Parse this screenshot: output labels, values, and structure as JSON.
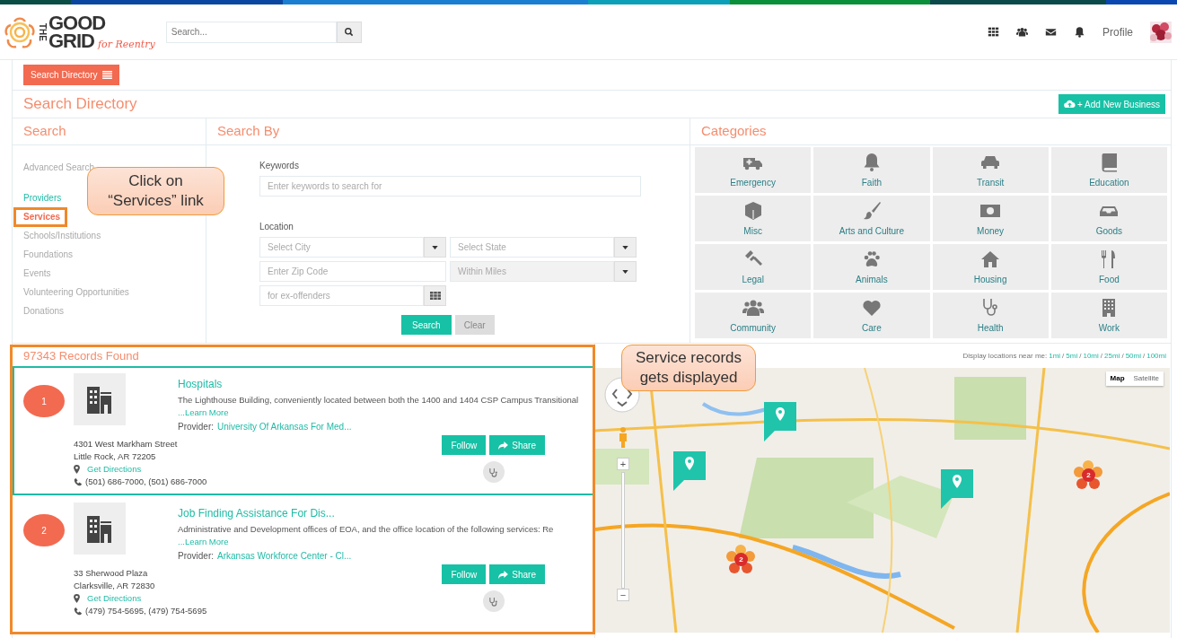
{
  "logo": {
    "the": "THE",
    "good": "GOOD",
    "grid": "GRID",
    "tagline": "for Reentry"
  },
  "header": {
    "search": {
      "placeholder": "Search..."
    },
    "profile": "Profile"
  },
  "toolbar": {
    "directory_button": "Search Directory"
  },
  "page": {
    "title": "Search Directory",
    "add_button": "+ Add New Business"
  },
  "search_panel": {
    "title": "Search",
    "advanced": "Advanced Search",
    "items": [
      {
        "label": "Providers",
        "color": "#1fbba6",
        "selected": false
      },
      {
        "label": "Services",
        "color": "#f26a50",
        "selected": true
      },
      {
        "label": "Schools/Institutions",
        "color": "#aaaaaa",
        "selected": false
      },
      {
        "label": "Foundations",
        "color": "#aaaaaa",
        "selected": false
      },
      {
        "label": "Events",
        "color": "#aaaaaa",
        "selected": false
      },
      {
        "label": "Volunteering Opportunities",
        "color": "#aaaaaa",
        "selected": false
      },
      {
        "label": "Donations",
        "color": "#aaaaaa",
        "selected": false
      }
    ]
  },
  "search_by": {
    "title": "Search By",
    "keywords_label": "Keywords",
    "keywords": {
      "placeholder": "Enter keywords to search for"
    },
    "location_label": "Location",
    "city": {
      "placeholder": "Select City",
      "disabled": false
    },
    "state": {
      "placeholder": "Select State",
      "disabled": false
    },
    "zip": {
      "placeholder": "Enter Zip Code"
    },
    "miles": {
      "placeholder": "Within Miles",
      "disabled": true
    },
    "tag": {
      "placeholder": "for ex-offenders"
    },
    "search_button": "Search",
    "clear_button": "Clear"
  },
  "categories": {
    "title": "Categories",
    "items": [
      {
        "label": "Emergency"
      },
      {
        "label": "Faith"
      },
      {
        "label": "Transit"
      },
      {
        "label": "Education"
      },
      {
        "label": "Misc"
      },
      {
        "label": "Arts and Culture"
      },
      {
        "label": "Money"
      },
      {
        "label": "Goods"
      },
      {
        "label": "Legal"
      },
      {
        "label": "Animals"
      },
      {
        "label": "Housing"
      },
      {
        "label": "Food"
      },
      {
        "label": "Community"
      },
      {
        "label": "Care"
      },
      {
        "label": "Health"
      },
      {
        "label": "Work"
      }
    ]
  },
  "results": {
    "count": "97343 Records Found",
    "records": [
      {
        "number": "1",
        "title": "Hospitals",
        "description": "The Lighthouse Building, conveniently located between both the 1400 and 1404 CSP Campus Transitional",
        "learn_more": "...Learn More",
        "provider_label": "Provider:",
        "provider": "University Of Arkansas For Med...",
        "address": [
          "4301 West Markham Street",
          "Little Rock, AR 72205"
        ],
        "directions": "Get Directions",
        "phone": "(501) 686-7000, (501) 686-7000",
        "follow": "Follow",
        "share": "Share",
        "selected": true
      },
      {
        "number": "2",
        "title": "Job Finding Assistance For Dis...",
        "description": "Administrative and Development offices of EOA, and the office location of the following services: Re",
        "learn_more": "...Learn More",
        "provider_label": "Provider:",
        "provider": "Arkansas Workforce Center - Cl...",
        "address": [
          "33 Sherwood Plaza",
          "Clarksville, AR 72830"
        ],
        "directions": "Get Directions",
        "phone": "(479) 754-5695, (479) 754-5695",
        "follow": "Follow",
        "share": "Share",
        "selected": false
      }
    ]
  },
  "map": {
    "near_label": "Display locations near me:",
    "distances": [
      "1mi",
      "5mi",
      "10mi",
      "25mi",
      "50mi",
      "100mi"
    ],
    "separator": "/",
    "map_types": [
      {
        "label": "Map",
        "selected": true
      },
      {
        "label": "Satellite",
        "selected": false
      }
    ],
    "zoom_in": "+",
    "zoom_out": "−",
    "clusters": [
      {
        "count": "2"
      },
      {
        "count": "2"
      }
    ]
  },
  "annotations": [
    {
      "text": "Click on “Services” link"
    },
    {
      "text": "Service records gets displayed"
    }
  ]
}
